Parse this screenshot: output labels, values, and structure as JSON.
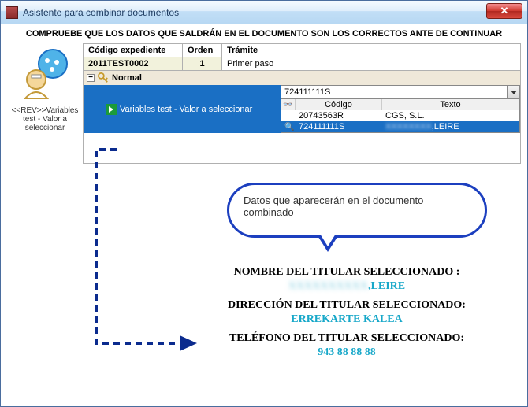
{
  "window": {
    "title": "Asistente para combinar documentos"
  },
  "banner": "COMPRUEBE QUE LOS DATOS QUE SALDRÁN EN EL DOCUMENTO SON LOS CORRECTOS ANTE DE CONTINUAR",
  "sidebar": {
    "rev_label": "<<REV>>Variables test - Valor a seleccionar"
  },
  "header_table": {
    "cols": {
      "codigo": "Código expediente",
      "orden": "Orden",
      "tramite": "Trámite"
    },
    "row": {
      "codigo": "2011TEST0002",
      "orden": "1",
      "tramite": "Primer paso"
    }
  },
  "tree": {
    "normal_label": "Normal",
    "variable_label": "Variables test - Valor a seleccionar",
    "selected_value": "724111111S"
  },
  "dropdown": {
    "col_code": "Código",
    "col_text": "Texto",
    "rows": [
      {
        "code": "20743563R",
        "text": "CGS, S.L."
      },
      {
        "code": "724111111S",
        "text_prefix": "",
        "text_blurred": "XXXXXXXX",
        "text_suffix": ",LEIRE",
        "selected": true
      }
    ]
  },
  "callout": {
    "text": "Datos que aparecerán en el documento combinado"
  },
  "document": {
    "name_label": "NOMBRE DEL TITULAR SELECCIONADO :",
    "name_value_blurred": "XXXXXXXXXX",
    "name_value_suffix": ",LEIRE",
    "addr_label": "DIRECCIÓN DEL TITULAR SELECCIONADO:",
    "addr_value": "ERREKARTE KALEA",
    "phone_label": "TELÉFONO DEL TITULAR SELECCIONADO:",
    "phone_value": "943 88 88 88"
  }
}
